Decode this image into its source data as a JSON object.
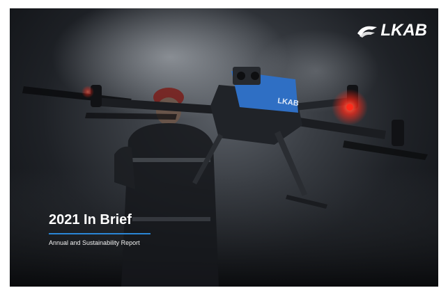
{
  "brand": {
    "logo_text": "LKAB",
    "accent_color": "#2a86d6",
    "drone_body_color": "#2f6fc4",
    "signal_light_color": "#ff2a1a"
  },
  "cover": {
    "title": "2021 In Brief",
    "subtitle": "Annual and Sustainability Report"
  }
}
